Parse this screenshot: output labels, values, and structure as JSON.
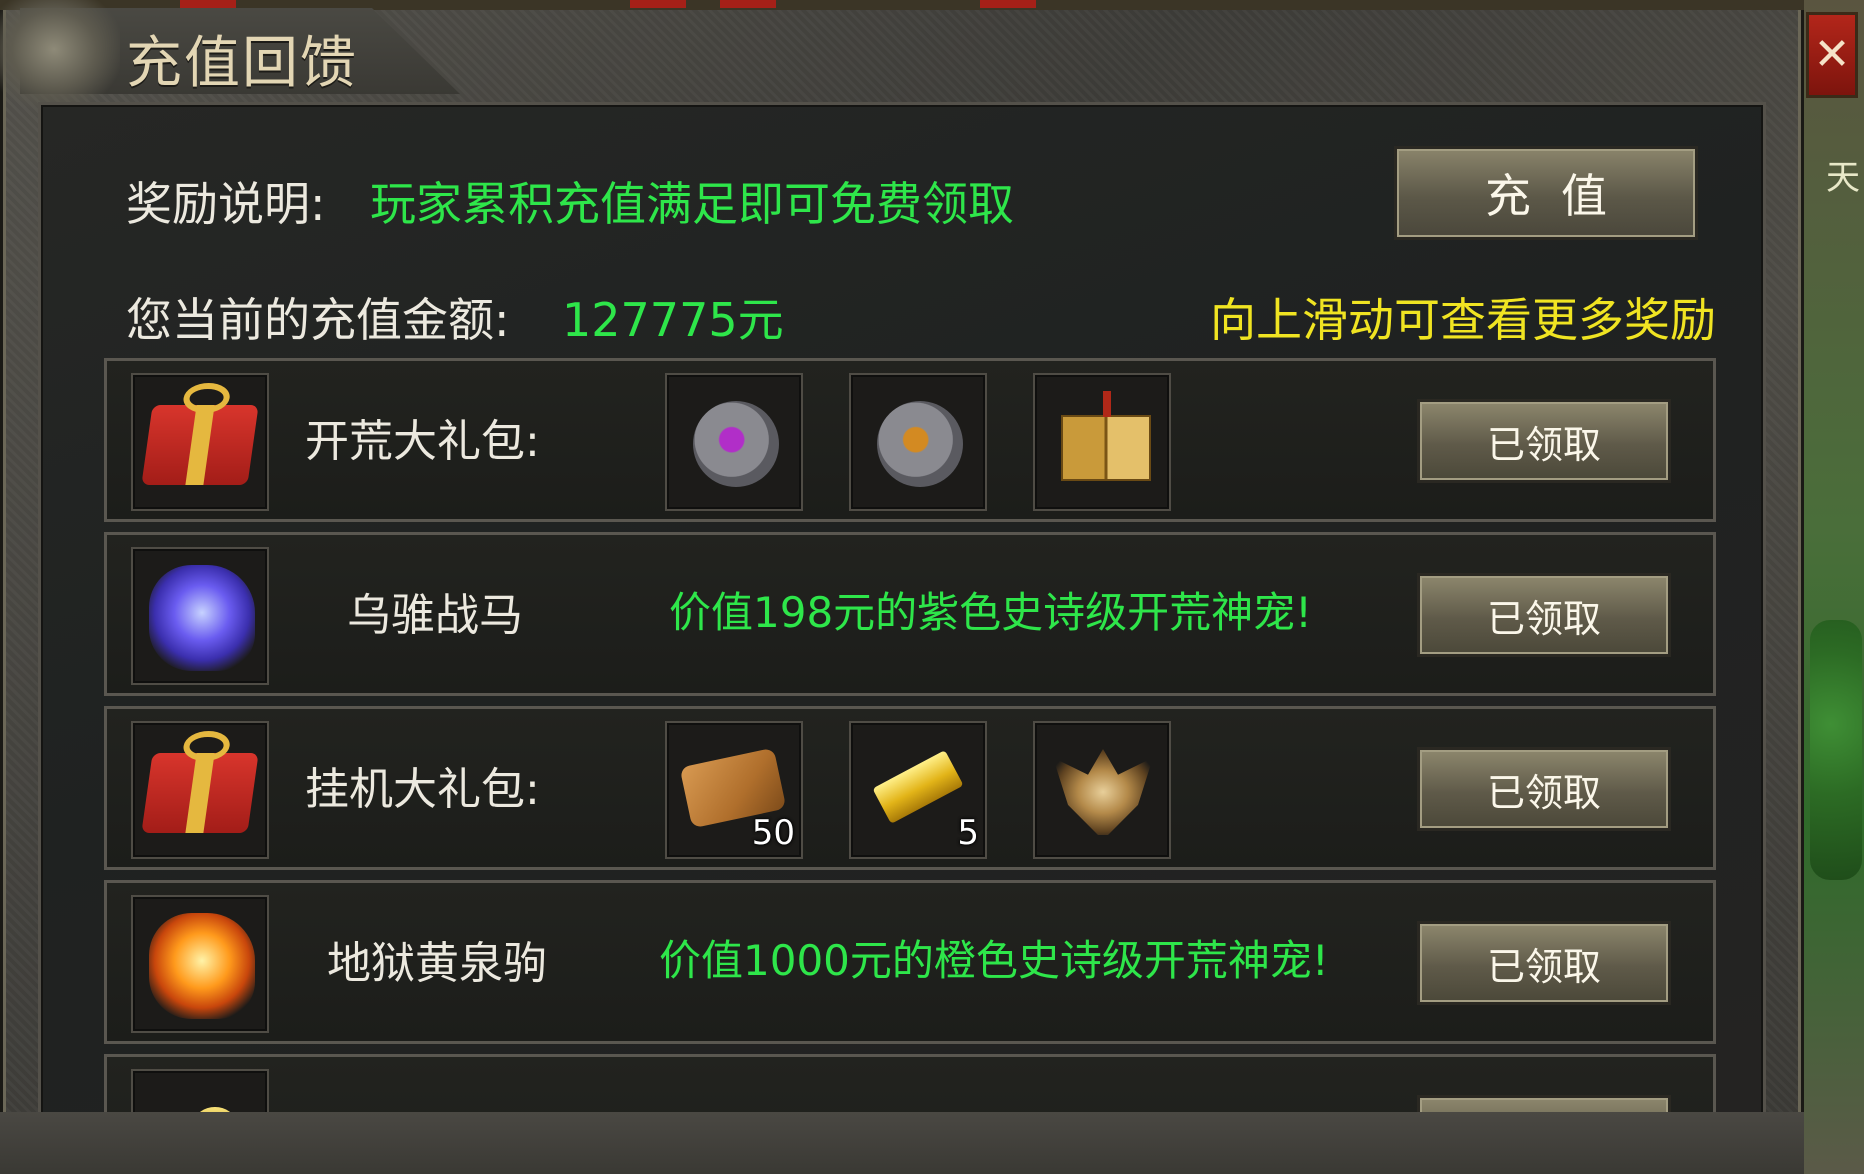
{
  "window": {
    "title": "充值回馈",
    "close_glyph": "✕"
  },
  "header": {
    "reward_label": "奖励说明:",
    "reward_text": "玩家累积充值满足即可免费领取",
    "recharge_button": "充值",
    "current_label": "您当前的充值金额:",
    "current_amount": "127775元",
    "scroll_hint": "向上滑动可查看更多奖励"
  },
  "rewards": [
    {
      "name": "开荒大礼包:",
      "icon": "gift-box-icon",
      "items": [
        {
          "icon": "purple-scroll-icon",
          "qty": ""
        },
        {
          "icon": "orange-scroll-icon",
          "qty": ""
        },
        {
          "icon": "skill-book-icon",
          "qty": ""
        }
      ],
      "button": "已领取"
    },
    {
      "name": "乌骓战马",
      "icon": "blue-warhorse-icon",
      "desc": "价值198元的紫色史诗级开荒神宠!",
      "button": "已领取"
    },
    {
      "name": "挂机大礼包:",
      "icon": "gift-box-icon",
      "items": [
        {
          "icon": "parchment-scroll-icon",
          "qty": "50"
        },
        {
          "icon": "gold-bar-icon",
          "qty": "5"
        },
        {
          "icon": "wings-emblem-icon",
          "qty": ""
        }
      ],
      "button": "已领取"
    },
    {
      "name": "地狱黄泉驹",
      "icon": "fire-steed-icon",
      "desc": "价值1000元的橙色史诗级开荒神宠!",
      "button": "已领取"
    }
  ],
  "colors": {
    "accent_green": "#2ee64a",
    "hint_yellow": "#f0e422",
    "close_red": "#b3261a"
  }
}
